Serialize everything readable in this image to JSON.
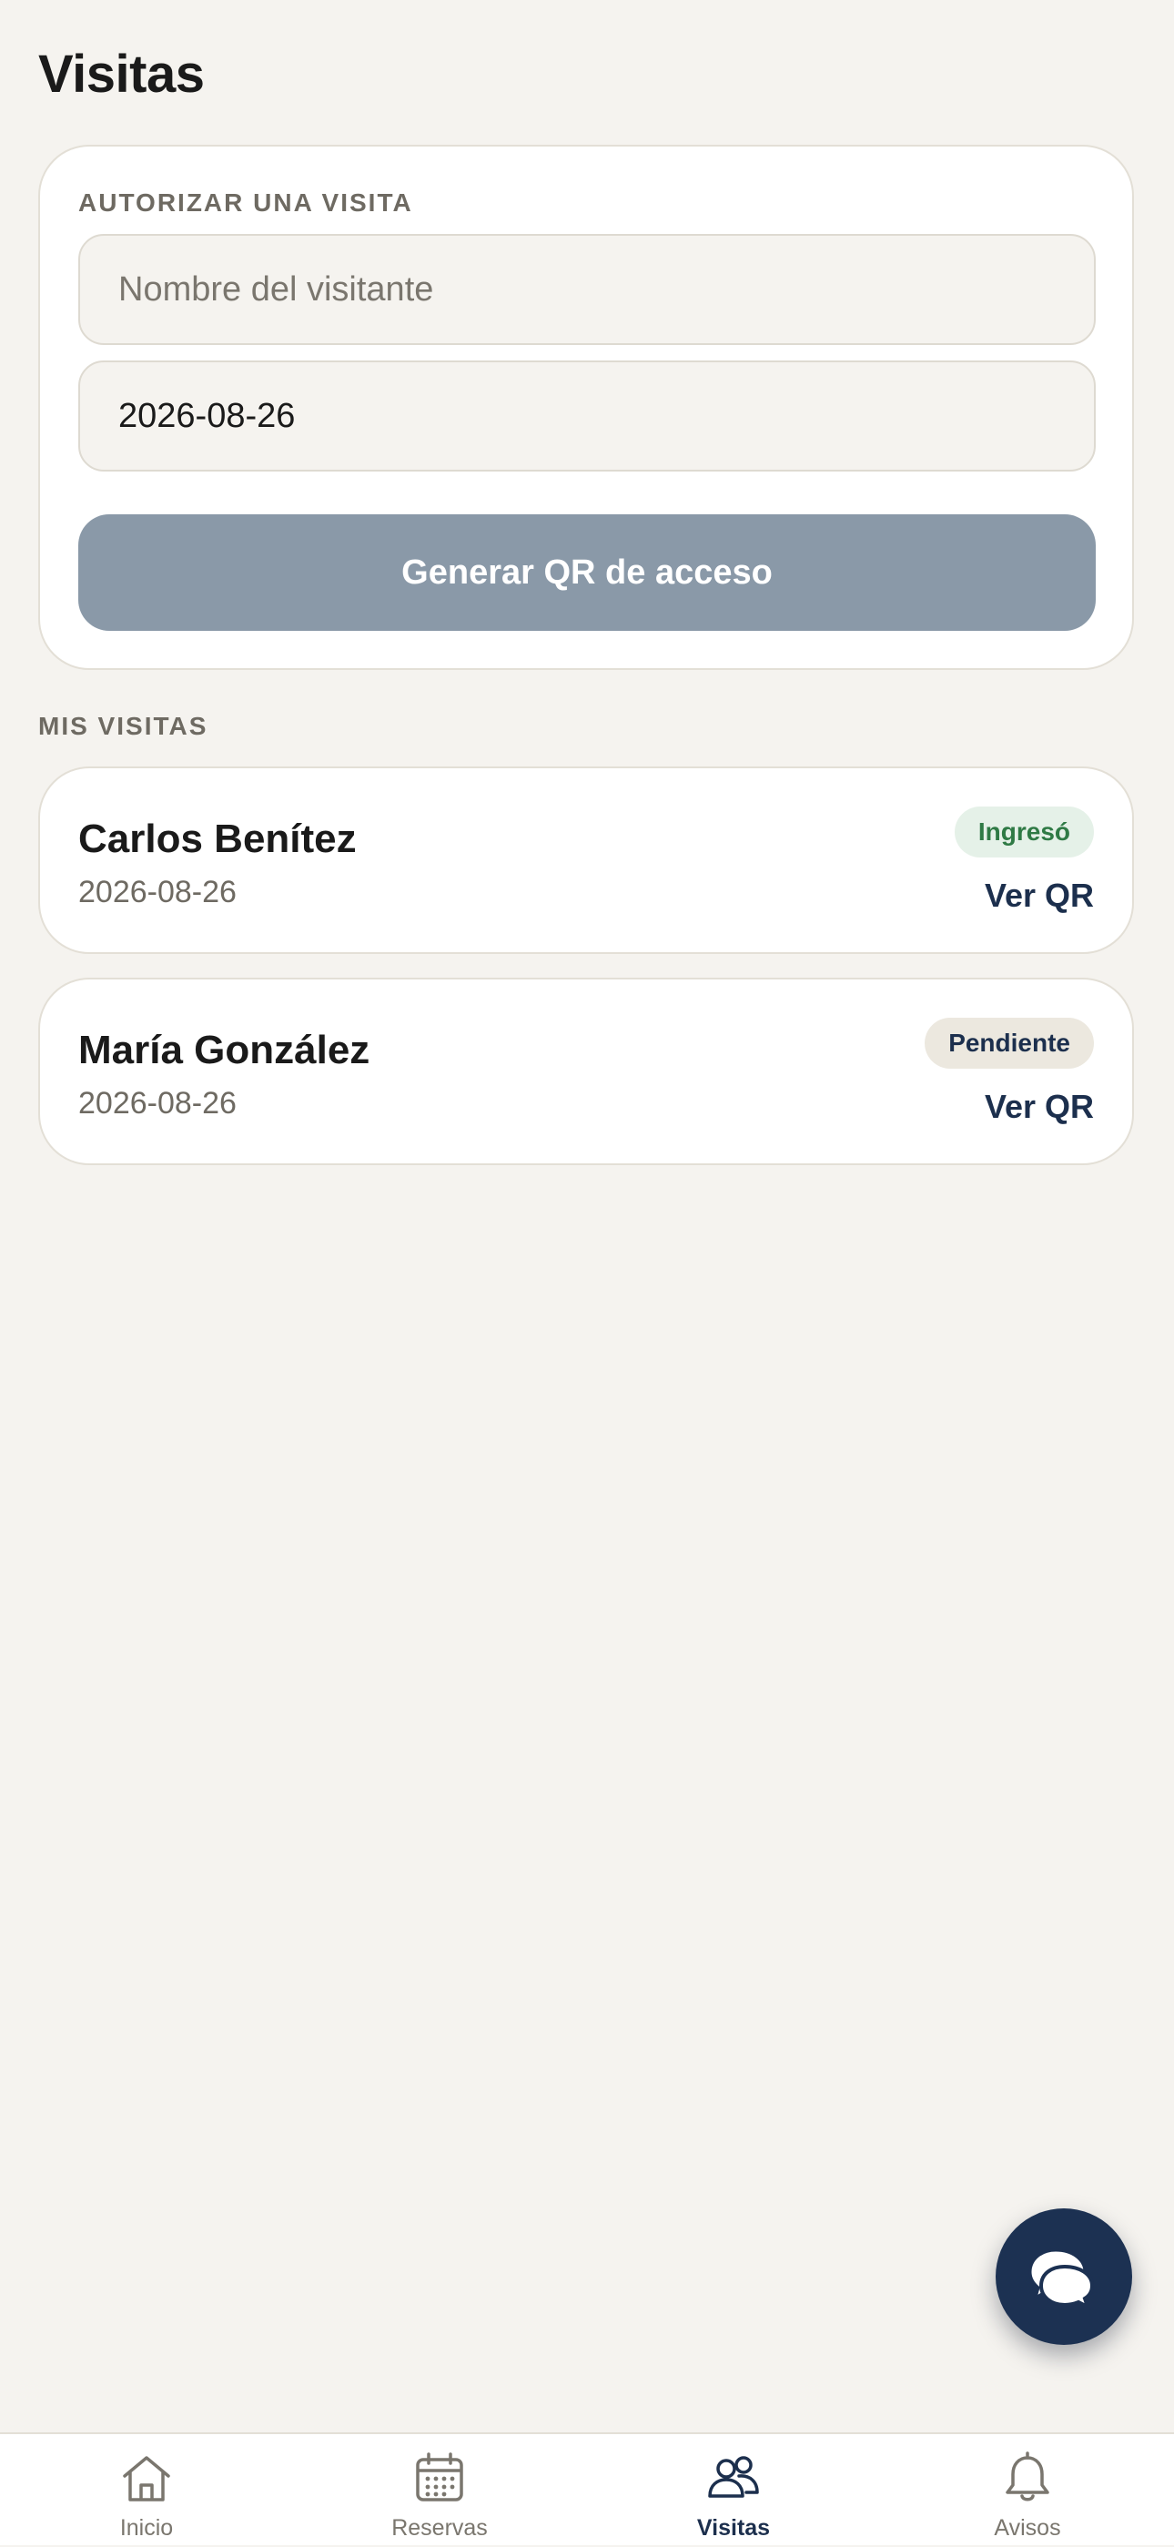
{
  "header": {
    "title": "Visitas"
  },
  "authorize": {
    "section_label": "AUTORIZAR UNA VISITA",
    "name_placeholder": "Nombre del visitante",
    "name_value": "",
    "date_value": "2026-08-26",
    "submit_label": "Generar QR de acceso"
  },
  "visits": {
    "section_label": "MIS VISITAS",
    "items": [
      {
        "name": "Carlos Benítez",
        "date": "2026-08-26",
        "status": "Ingresó",
        "action_label": "Ver QR"
      },
      {
        "name": "María González",
        "date": "2026-08-26",
        "status": "Pendiente",
        "action_label": "Ver QR"
      }
    ]
  },
  "chat_button": {
    "icon": "chat-bubbles-icon"
  },
  "tabbar": {
    "items": [
      {
        "label": "Inicio",
        "icon": "home-icon"
      },
      {
        "label": "Reservas",
        "icon": "calendar-icon"
      },
      {
        "label": "Visitas",
        "icon": "users-icon"
      },
      {
        "label": "Avisos",
        "icon": "bell-icon"
      }
    ],
    "active": "Visitas"
  },
  "colors": {
    "background": "#f5f3ef",
    "primary": "#1c3152",
    "button_disabled": "#8a99a8",
    "status_entered_bg": "#e5f1e8",
    "status_entered_text": "#2f7a45",
    "status_pending_bg": "#ece8df",
    "status_pending_text": "#1c2f4d"
  }
}
